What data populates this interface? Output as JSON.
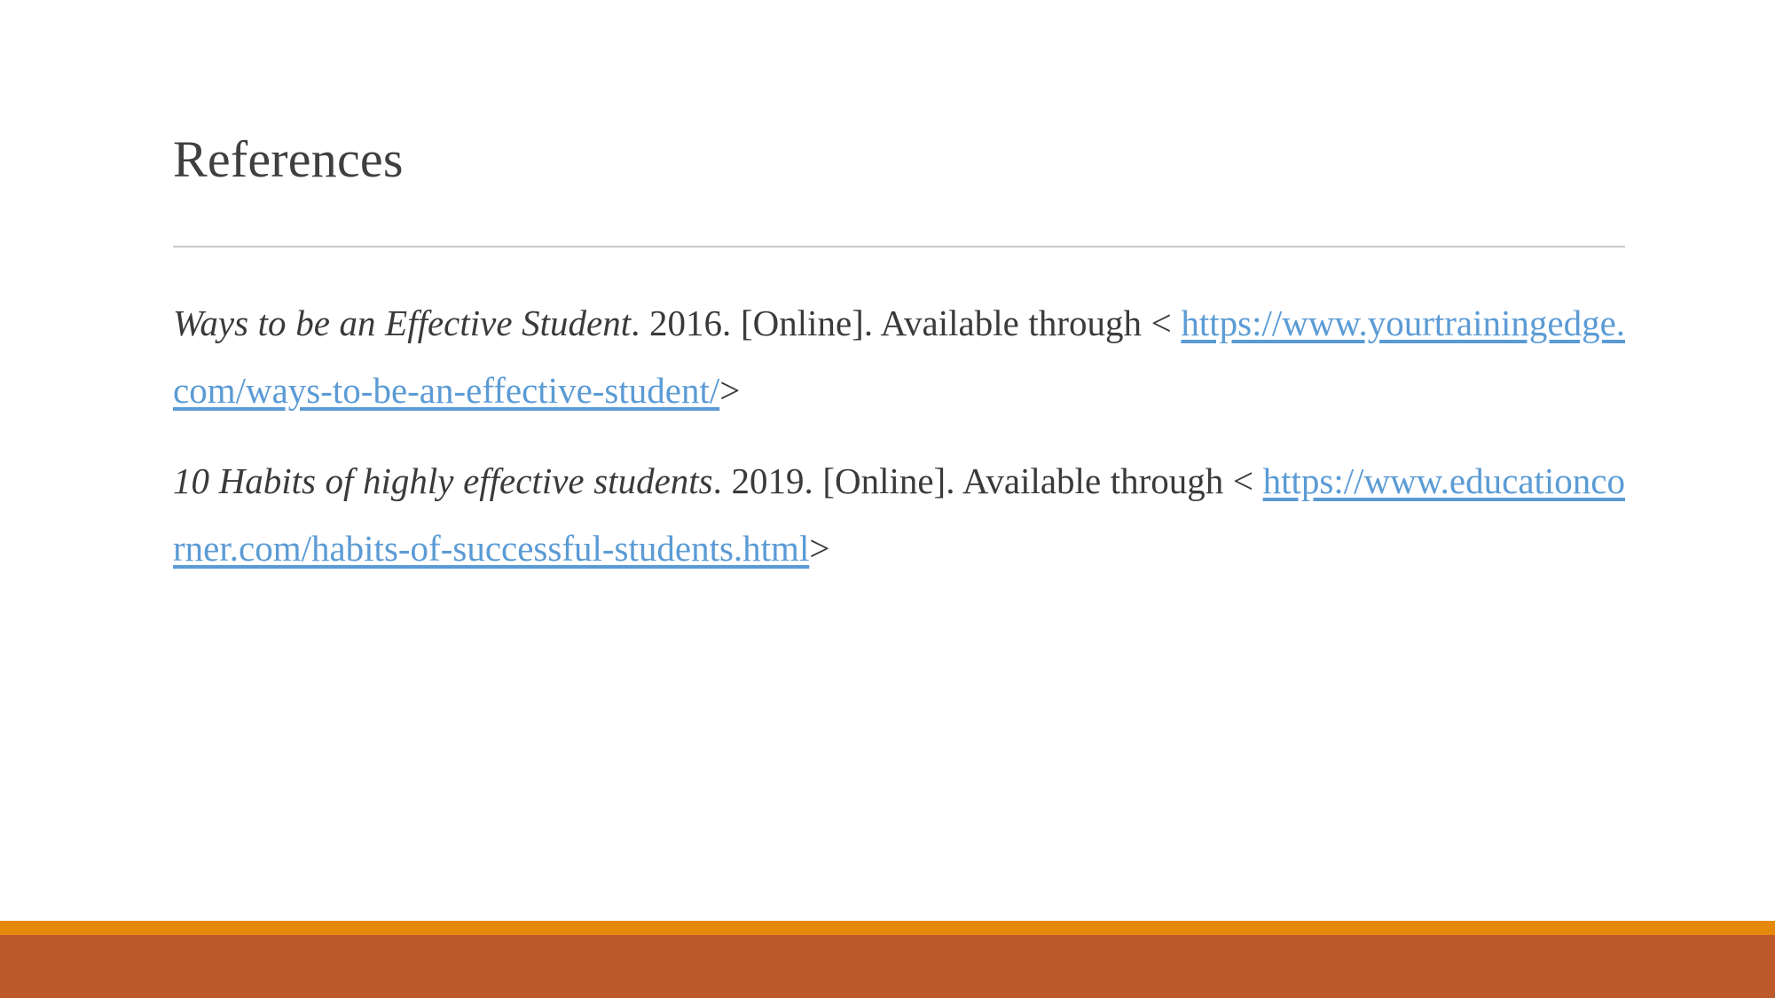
{
  "slide": {
    "title": "References",
    "background_color": "#ffffff",
    "divider_color": "#c9c9c9",
    "text_color": "#3a3a3a",
    "link_color": "#5b9bd5"
  },
  "references": [
    {
      "title": "Ways to be an Effective Student",
      "title_terminator": ".",
      "year": "2016.",
      "availability": "[Online].",
      "available_through": "Available through",
      "open_bracket": "<",
      "url": "https://www.yourtrainingedge.com/ways-to-be-an-effective-student/",
      "close_bracket": ">"
    },
    {
      "title": "10 Habits of highly effective students",
      "title_terminator": ".",
      "year": "2019.",
      "availability": "[Online].",
      "available_through": "Available through",
      "open_bracket": "<",
      "url": "https://www.educationcorner.com/habits-of-successful-students.html",
      "close_bracket": ">"
    }
  ],
  "footer": {
    "bar_top_color": "#e5890d",
    "bar_bottom_color": "#bc5a2c"
  }
}
